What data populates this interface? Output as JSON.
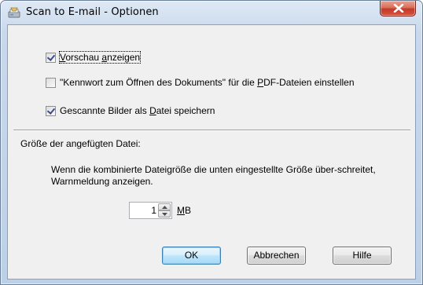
{
  "window": {
    "title": "Scan to E-mail - Optionen"
  },
  "options": {
    "preview": {
      "label_pre": "",
      "label_key": "V",
      "label_post": "orschau ",
      "label_key2": "a",
      "label_post2": "nzeigen",
      "checked": true
    },
    "password": {
      "label_pre": "\"Kennwort zum Öffnen des Dokuments\" für die ",
      "label_key": "P",
      "label_post": "DF-Dateien einstellen",
      "checked": false
    },
    "save_file": {
      "label_pre": "Gescannte Bilder als ",
      "label_key": "D",
      "label_post": "atei speichern",
      "checked": true
    }
  },
  "attachment": {
    "section_label": "Größe der angefügten Datei:",
    "info_text": "Wenn die kombinierte Dateigröße die unten eingestellte Größe über-schreitet, Warnmeldung anzeigen.",
    "size_value": "1",
    "unit_key": "M",
    "unit_rest": "B"
  },
  "buttons": {
    "ok": "OK",
    "cancel": "Abbrechen",
    "help": "Hilfe"
  },
  "icons": {
    "title": "scanner-mail-icon",
    "close": "close-icon"
  },
  "colors": {
    "frame": "#c9d9ec",
    "client": "#f0f0f0",
    "close_button": "#c4382a",
    "default_button_border": "#3c7fb1"
  }
}
